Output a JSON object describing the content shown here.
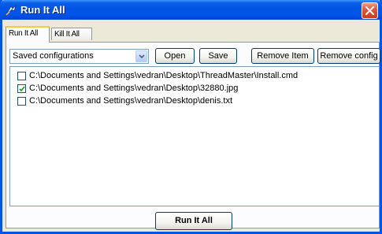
{
  "window": {
    "title": "Run It All",
    "close_icon": "close-icon",
    "app_icon": "runner-icon"
  },
  "tabs": [
    {
      "label": "Run It All",
      "active": true
    },
    {
      "label": "Kill It All",
      "active": false
    }
  ],
  "config": {
    "selected": "Saved configurations",
    "open_label": "Open",
    "save_label": "Save",
    "remove_item_label": "Remove Item",
    "remove_config_label": "Remove config"
  },
  "items": [
    {
      "path": "C:\\Documents and Settings\\vedran\\Desktop\\ThreadMaster\\Install.cmd",
      "checked": false
    },
    {
      "path": "C:\\Documents and Settings\\vedran\\Desktop\\32880.jpg",
      "checked": true
    },
    {
      "path": "C:\\Documents and Settings\\vedran\\Desktop\\denis.txt",
      "checked": false
    }
  ],
  "run_label": "Run It All",
  "colors": {
    "titlebar": "#0054e3",
    "close": "#e0583a",
    "tab_highlight": "#ffc83c"
  }
}
